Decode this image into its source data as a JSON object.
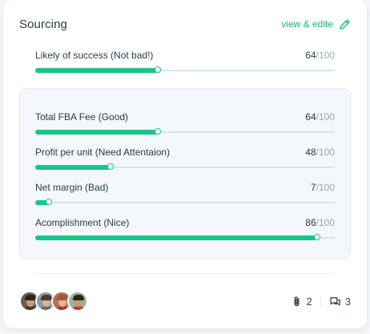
{
  "header": {
    "title": "Sourcing",
    "edit_label": "view & edite"
  },
  "colors": {
    "accent": "#16c784",
    "track": "#d4e4f1",
    "link": "#14b87a"
  },
  "primary_metric": {
    "label": "Likely of success (Not bad!)",
    "score": "64",
    "max": "/100",
    "progress": 0.41
  },
  "metrics": [
    {
      "label": "Total FBA Fee (Good)",
      "score": "64",
      "max": "/100",
      "progress": 0.41
    },
    {
      "label": "Profit per unit (Need Attentaion)",
      "score": "48",
      "max": "/100",
      "progress": 0.25
    },
    {
      "label": "Net margin (Bad)",
      "score": "7",
      "max": "/100",
      "progress": 0.045
    },
    {
      "label": "Acomplishment (Nice)",
      "score": "86",
      "max": "/100",
      "progress": 0.94
    }
  ],
  "footer": {
    "avatars": [
      {
        "name": "avatar",
        "bg": "#6b5a4e",
        "skin": "#c99a78",
        "hair": "#2a2320",
        "shirt": "#3a3a3a"
      },
      {
        "name": "avatar",
        "bg": "#8d9aa6",
        "skin": "#d8b494",
        "hair": "#4a3a2c",
        "shirt": "#5d6e80"
      },
      {
        "name": "avatar",
        "bg": "#b86b5c",
        "skin": "#e0b898",
        "hair": "#a05a40",
        "shirt": "#9c3c34"
      },
      {
        "name": "avatar",
        "bg": "#9fb0a0",
        "skin": "#c59a7a",
        "hair": "#2b2420",
        "shirt": "#c23a3a"
      }
    ],
    "attachments": "2",
    "comments": "3"
  }
}
